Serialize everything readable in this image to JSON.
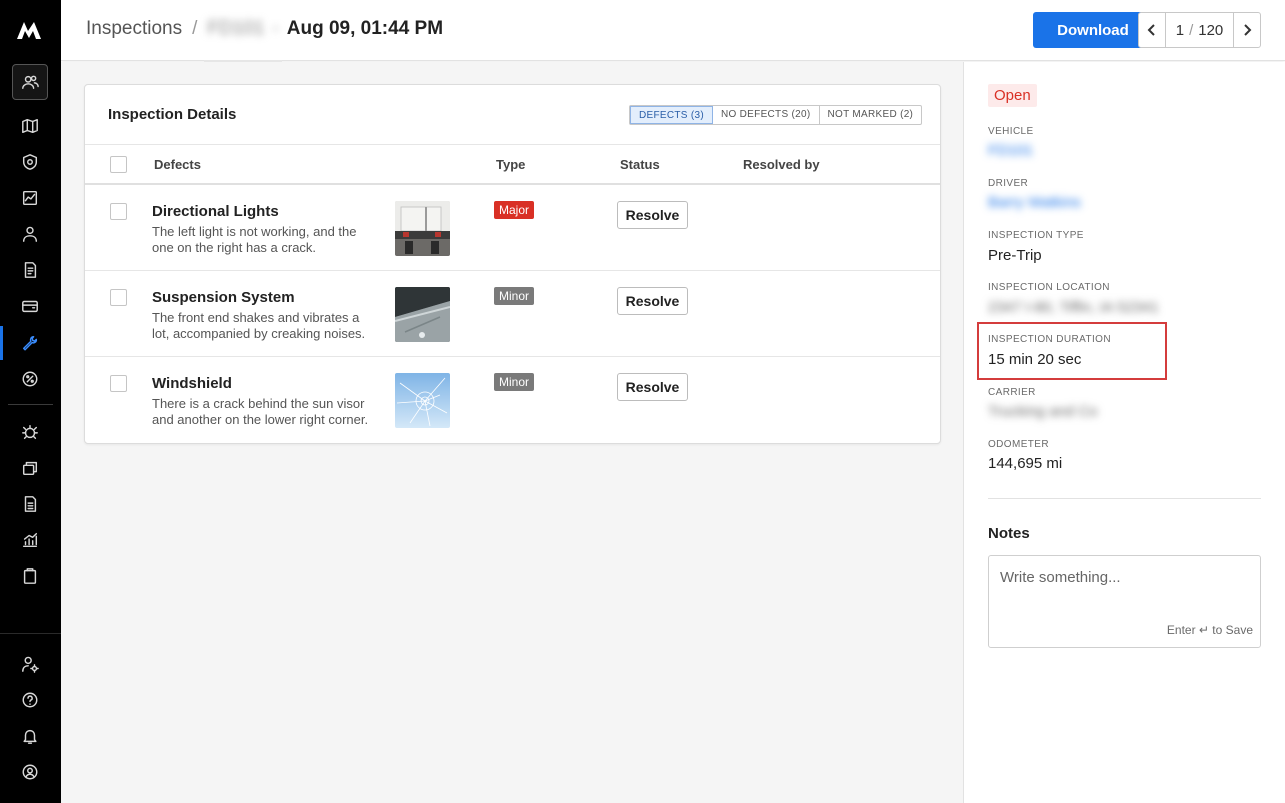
{
  "header": {
    "breadcrumb_root": "Inspections",
    "breadcrumb_sep": "/",
    "vehicle_blurred": "FD101",
    "breadcrumb_dash": "-",
    "title": "Aug 09, 01:44 PM",
    "download_label": "Download",
    "pager_current": "1",
    "pager_sep": "/",
    "pager_total": "120"
  },
  "card": {
    "title": "Inspection Details",
    "filters": [
      "DEFECTS (3)",
      "NO DEFECTS (20)",
      "NOT MARKED (2)"
    ],
    "columns": [
      "Defects",
      "Type",
      "Status",
      "Resolved by"
    ],
    "rows": [
      {
        "title": "Directional Lights",
        "desc": "The left light is not working, and the one on the right has a crack.",
        "type": "Major",
        "action": "Resolve"
      },
      {
        "title": "Suspension System",
        "desc": "The front end shakes and vibrates a lot, accompanied by creaking noises.",
        "type": "Minor",
        "action": "Resolve"
      },
      {
        "title": "Windshield",
        "desc": "There is a crack behind the sun visor and another on the lower right corner.",
        "type": "Minor",
        "action": "Resolve"
      }
    ]
  },
  "panel": {
    "status": "Open",
    "vehicle_label": "VEHICLE",
    "vehicle_value": "FD101",
    "driver_label": "DRIVER",
    "driver_value": "Barry Watkins",
    "type_label": "INSPECTION TYPE",
    "type_value": "Pre-Trip",
    "location_label": "INSPECTION LOCATION",
    "location_value": "2347 I-80, Tiffin, IA 52341",
    "duration_label": "INSPECTION DURATION",
    "duration_value": "15 min 20 sec",
    "carrier_label": "CARRIER",
    "carrier_value": "Trucking and Co",
    "odometer_label": "ODOMETER",
    "odometer_value": "144,695 mi",
    "notes_title": "Notes",
    "notes_placeholder": "Write something...",
    "notes_hint": "Enter ↵ to Save"
  },
  "colors": {
    "accent": "#1a73e8",
    "major": "#d93025",
    "minor": "#7a7a7a",
    "highlight": "#d43c3c"
  },
  "sidebar_icons": [
    "logo-icon",
    "users-icon",
    "map-icon",
    "shield-icon",
    "dashboard-icon",
    "driver-icon",
    "document-icon",
    "wallet-icon",
    "wrench-icon",
    "badge-icon",
    "bug-icon",
    "cards-icon",
    "report-icon",
    "analytics-icon",
    "clipboard-icon",
    "user-settings-icon",
    "help-icon",
    "bell-icon",
    "profile-icon"
  ]
}
